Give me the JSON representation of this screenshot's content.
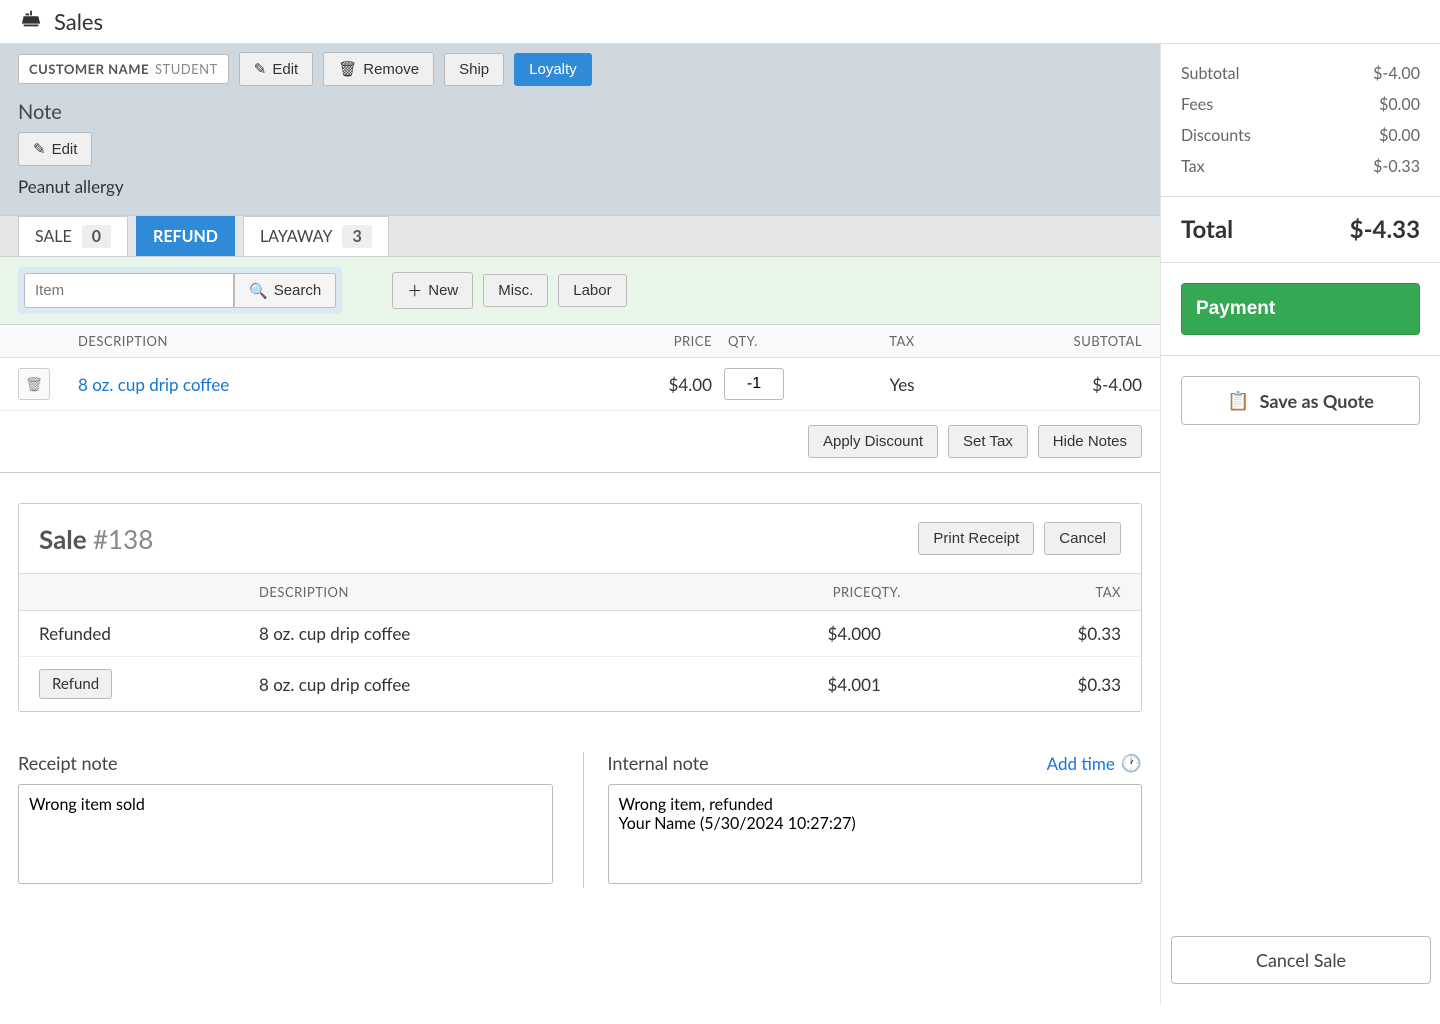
{
  "header": {
    "title": "Sales"
  },
  "customer": {
    "name_label": "CUSTOMER NAME",
    "role": "STUDENT",
    "edit": "Edit",
    "remove": "Remove",
    "ship": "Ship",
    "loyalty": "Loyalty"
  },
  "note": {
    "heading": "Note",
    "edit": "Edit",
    "text": "Peanut allergy"
  },
  "tabs": {
    "sale": {
      "label": "SALE",
      "count": "0"
    },
    "refund": {
      "label": "REFUND"
    },
    "layaway": {
      "label": "LAYAWAY",
      "count": "3"
    }
  },
  "search": {
    "placeholder": "Item",
    "search_btn": "Search",
    "new_btn": "New",
    "misc_btn": "Misc.",
    "labor_btn": "Labor"
  },
  "line_headers": {
    "description": "DESCRIPTION",
    "price": "PRICE",
    "qty": "QTY.",
    "tax": "TAX",
    "subtotal": "SUBTOTAL"
  },
  "line_item": {
    "description": "8 oz. cup drip coffee",
    "price": "$4.00",
    "qty": "-1",
    "tax": "Yes",
    "subtotal": "$-4.00"
  },
  "line_actions": {
    "discount": "Apply Discount",
    "settax": "Set Tax",
    "hidenotes": "Hide Notes"
  },
  "sale_box": {
    "title_prefix": "Sale ",
    "title_number": "#138",
    "print": "Print Receipt",
    "cancel": "Cancel",
    "headers": {
      "description": "DESCRIPTION",
      "price": "PRICE",
      "qty": "QTY.",
      "tax": "TAX"
    },
    "rows": [
      {
        "status": "Refunded",
        "desc": "8 oz. cup drip coffee",
        "price": "$4.00",
        "qty": "0",
        "tax": "$0.33"
      },
      {
        "status_btn": "Refund",
        "desc": "8 oz. cup drip coffee",
        "price": "$4.00",
        "qty": "1",
        "tax": "$0.33"
      }
    ]
  },
  "receipt_note": {
    "title": "Receipt note",
    "value": "Wrong item sold"
  },
  "internal_note": {
    "title": "Internal note",
    "add_time": "Add time",
    "value": "Wrong item, refunded\nYour Name (5/30/2024 10:27:27)"
  },
  "totals": {
    "subtotal_label": "Subtotal",
    "subtotal": "$-4.00",
    "fees_label": "Fees",
    "fees": "$0.00",
    "discounts_label": "Discounts",
    "discounts": "$0.00",
    "tax_label": "Tax",
    "tax": "$-0.33",
    "total_label": "Total",
    "total": "$-4.33"
  },
  "buttons": {
    "payment": "Payment",
    "save_quote": "Save as Quote",
    "cancel_sale": "Cancel Sale"
  }
}
